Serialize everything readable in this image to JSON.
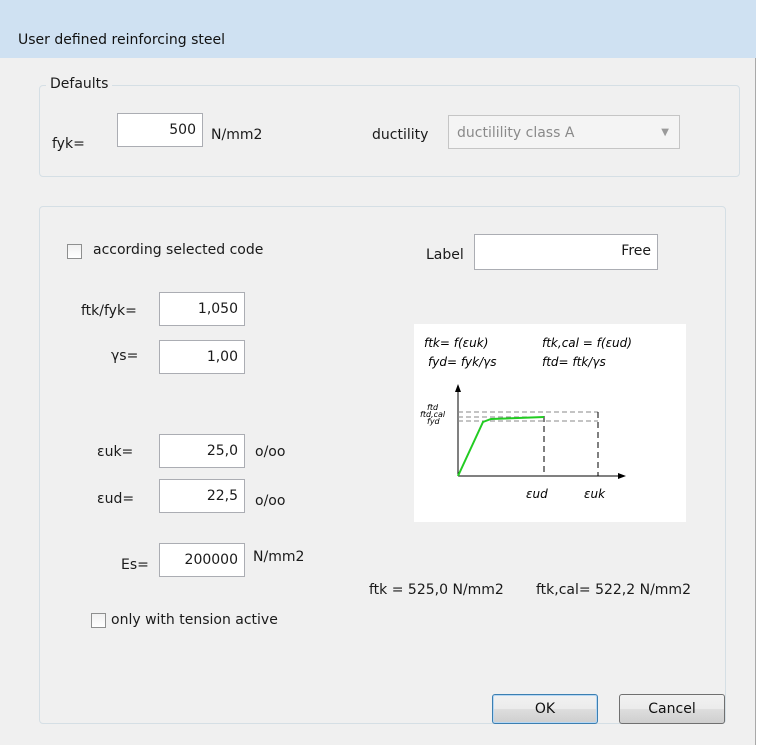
{
  "window": {
    "title": "User defined reinforcing steel"
  },
  "defaults": {
    "legend": "Defaults",
    "fyk_label": "fyk=",
    "fyk_value": "500",
    "fyk_unit": "N/mm2",
    "ductility_label": "ductility",
    "ductility_value": "ductilility class A"
  },
  "code": {
    "according_label": "according selected code",
    "according_checked": false,
    "label_label": "Label",
    "label_value": "Free"
  },
  "params": {
    "ftk_fyk_label": "ftk/fyk=",
    "ftk_fyk_value": "1,050",
    "gamma_s_label": "γs=",
    "gamma_s_value": "1,00",
    "euk_label": "εuk=",
    "euk_value": "25,0",
    "euk_unit": "o/oo",
    "eud_label": "εud=",
    "eud_value": "22,5",
    "eud_unit": "o/oo",
    "es_label": "Es=",
    "es_value": "200000",
    "es_unit": "N/mm2",
    "tension_label": "only with tension active",
    "tension_checked": false
  },
  "diagram": {
    "formula_ftk": "ftk= f(εuk)",
    "formula_ftkcal": "ftk,cal = f(εud)",
    "formula_fyd": "fyd= fyk/γs",
    "formula_ftd": "ftd= ftk/γs",
    "label_ftd": "ftd",
    "label_ftdcal": "ftd,cal",
    "label_fyd": "fyd",
    "label_eud": "εud",
    "label_euk": "εuk",
    "curve_color": "#22cc22"
  },
  "results": {
    "ftk_text": "ftk  =  525,0 N/mm2",
    "ftkcal_text": "ftk,cal=  522,2 N/mm2"
  },
  "buttons": {
    "ok": "OK",
    "cancel": "Cancel"
  }
}
